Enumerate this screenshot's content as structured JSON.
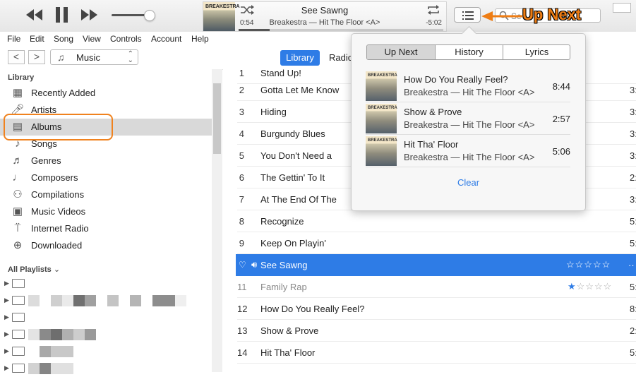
{
  "player": {
    "now_title": "See Sawng",
    "now_subtitle": "Breakestra — Hit The Floor  <A>",
    "elapsed": "0:54",
    "remaining": "-5:02",
    "progress_fraction": 0.15,
    "volume_fraction": 0.85,
    "album_art_text": "BREAKESTRA",
    "search_placeholder": "Se",
    "annotation": "Up Next",
    "accent_color": "#2e7ce6",
    "annotation_color": "#ee7d14"
  },
  "menu": [
    "File",
    "Edit",
    "Song",
    "View",
    "Controls",
    "Account",
    "Help"
  ],
  "nav": {
    "back": "<",
    "forward": ">",
    "media_kind": "Music",
    "tabs": [
      "Library",
      "Radio"
    ]
  },
  "sidebar": {
    "library_heading": "Library",
    "items": [
      {
        "label": "Recently Added",
        "icon": "recently-added-icon"
      },
      {
        "label": "Artists",
        "icon": "microphone-icon"
      },
      {
        "label": "Albums",
        "icon": "album-icon"
      },
      {
        "label": "Songs",
        "icon": "note-icon"
      },
      {
        "label": "Genres",
        "icon": "genres-icon"
      },
      {
        "label": "Composers",
        "icon": "composers-icon"
      },
      {
        "label": "Compilations",
        "icon": "compilations-icon"
      },
      {
        "label": "Music Videos",
        "icon": "video-icon"
      },
      {
        "label": "Internet Radio",
        "icon": "antenna-icon"
      },
      {
        "label": "Downloaded",
        "icon": "download-icon"
      }
    ],
    "playlists_heading": "All Playlists"
  },
  "songs": [
    {
      "num": "1",
      "name": "Stand Up!",
      "time": ""
    },
    {
      "num": "2",
      "name": "Gotta Let Me Know",
      "time": "3:"
    },
    {
      "num": "3",
      "name": "Hiding",
      "time": "3:"
    },
    {
      "num": "4",
      "name": "Burgundy Blues",
      "time": "3:"
    },
    {
      "num": "5",
      "name": "You Don't Need a",
      "time": "3:"
    },
    {
      "num": "6",
      "name": "The Gettin' To It",
      "time": "2:"
    },
    {
      "num": "7",
      "name": "At The End Of The",
      "time": "3:"
    },
    {
      "num": "8",
      "name": "Recognize",
      "time": "5:"
    },
    {
      "num": "9",
      "name": "Keep On Playin'",
      "time": "5:"
    },
    {
      "num": "10",
      "name": "See Sawng",
      "time": "··",
      "stars": "☆☆☆☆☆"
    },
    {
      "num": "11",
      "name": "Family Rap",
      "time": "5:",
      "stars": "★☆☆☆☆"
    },
    {
      "num": "12",
      "name": "How Do You Really Feel?",
      "time": "8:"
    },
    {
      "num": "13",
      "name": "Show & Prove",
      "time": "2:"
    },
    {
      "num": "14",
      "name": "Hit Tha' Floor",
      "time": "5:"
    }
  ],
  "upnext": {
    "tabs": [
      "Up Next",
      "History",
      "Lyrics"
    ],
    "items": [
      {
        "title": "How Do You Really Feel?",
        "subtitle": "Breakestra — Hit The Floor  <A>",
        "time": "8:44"
      },
      {
        "title": "Show & Prove",
        "subtitle": "Breakestra — Hit The Floor  <A>",
        "time": "2:57"
      },
      {
        "title": "Hit Tha' Floor",
        "subtitle": "Breakestra — Hit The Floor  <A>",
        "time": "5:06"
      }
    ],
    "clear": "Clear"
  }
}
